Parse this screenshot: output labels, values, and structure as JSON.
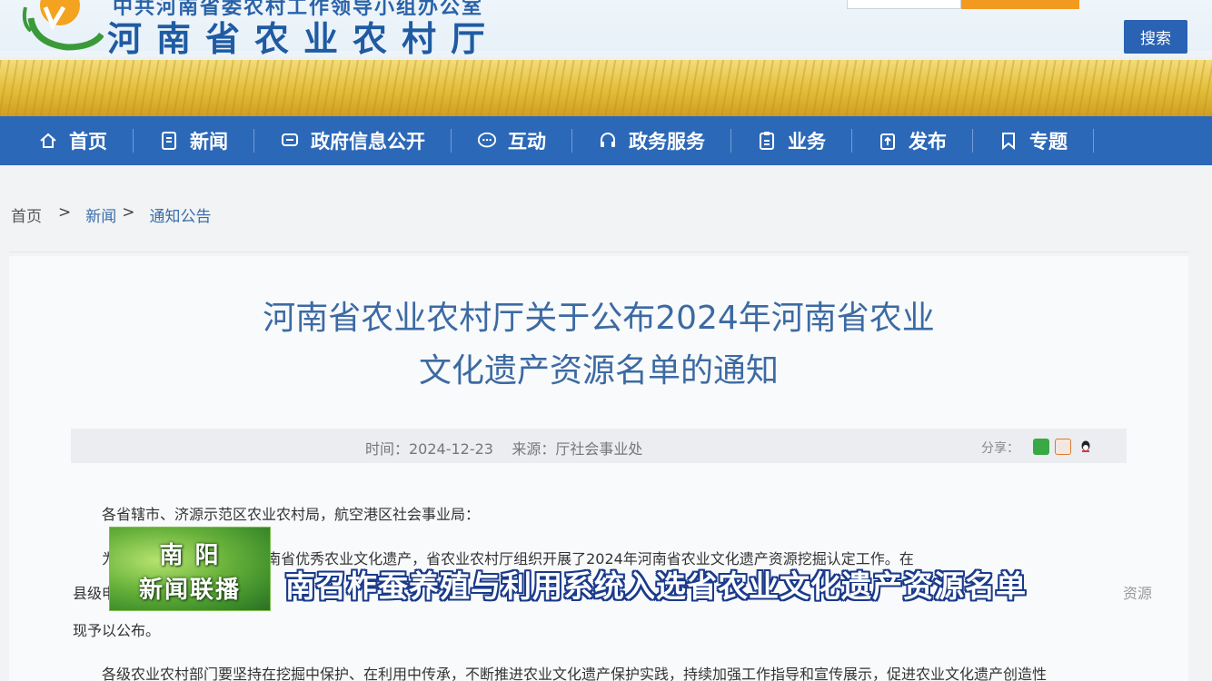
{
  "header": {
    "org_top": "中共河南省委农村工作领导小组办公室",
    "org_name": "河南省农业农村厅",
    "search_button": "搜索",
    "accent_orange": "#f29a1f",
    "brand_blue": "#2c68b8"
  },
  "nav": {
    "items": [
      {
        "label": "首页",
        "icon": "home-icon"
      },
      {
        "label": "新闻",
        "icon": "document-icon"
      },
      {
        "label": "政府信息公开",
        "icon": "chat-icon"
      },
      {
        "label": "互动",
        "icon": "speech-bubble-icon"
      },
      {
        "label": "政务服务",
        "icon": "headset-icon"
      },
      {
        "label": "业务",
        "icon": "clipboard-icon"
      },
      {
        "label": "发布",
        "icon": "upload-icon"
      },
      {
        "label": "专题",
        "icon": "bookmark-icon"
      }
    ]
  },
  "breadcrumb": {
    "home": "首页",
    "sep": ">",
    "news": "新闻",
    "current": "通知公告"
  },
  "article": {
    "title_line1": "河南省农业农村厅关于公布2024年河南省农业",
    "title_line2": "文化遗产资源名单的通知",
    "meta": "时间：2024-12-23    来源：厅社会事业处",
    "share_label": "分享：",
    "salutation": "各省辖市、济源示范区农业农村局，航空港区社会事业局：",
    "para1_partial": "为                                          传承利用，深入发掘河南省优秀农业文化遗产，省农业农村厅组织开展了2024年河南省农业文化遗产资源挖掘认定工作。在",
    "para1_line2_start": "县级申",
    "para1_line2_end": "资源",
    "para1_line3": "现予以公布。",
    "para2": "各级农业农村部门要坚持在挖掘中保护、在利用中传承，不断推进农业文化遗产保护实践，持续加强工作指导和宣传展示，促进农业文化遗产创造性"
  },
  "tv_overlay": {
    "channel_line1": "南 阳",
    "channel_line2": "新闻联播",
    "headline": "南召柞蚕养殖与利用系统入选省农业文化遗产资源名单"
  }
}
